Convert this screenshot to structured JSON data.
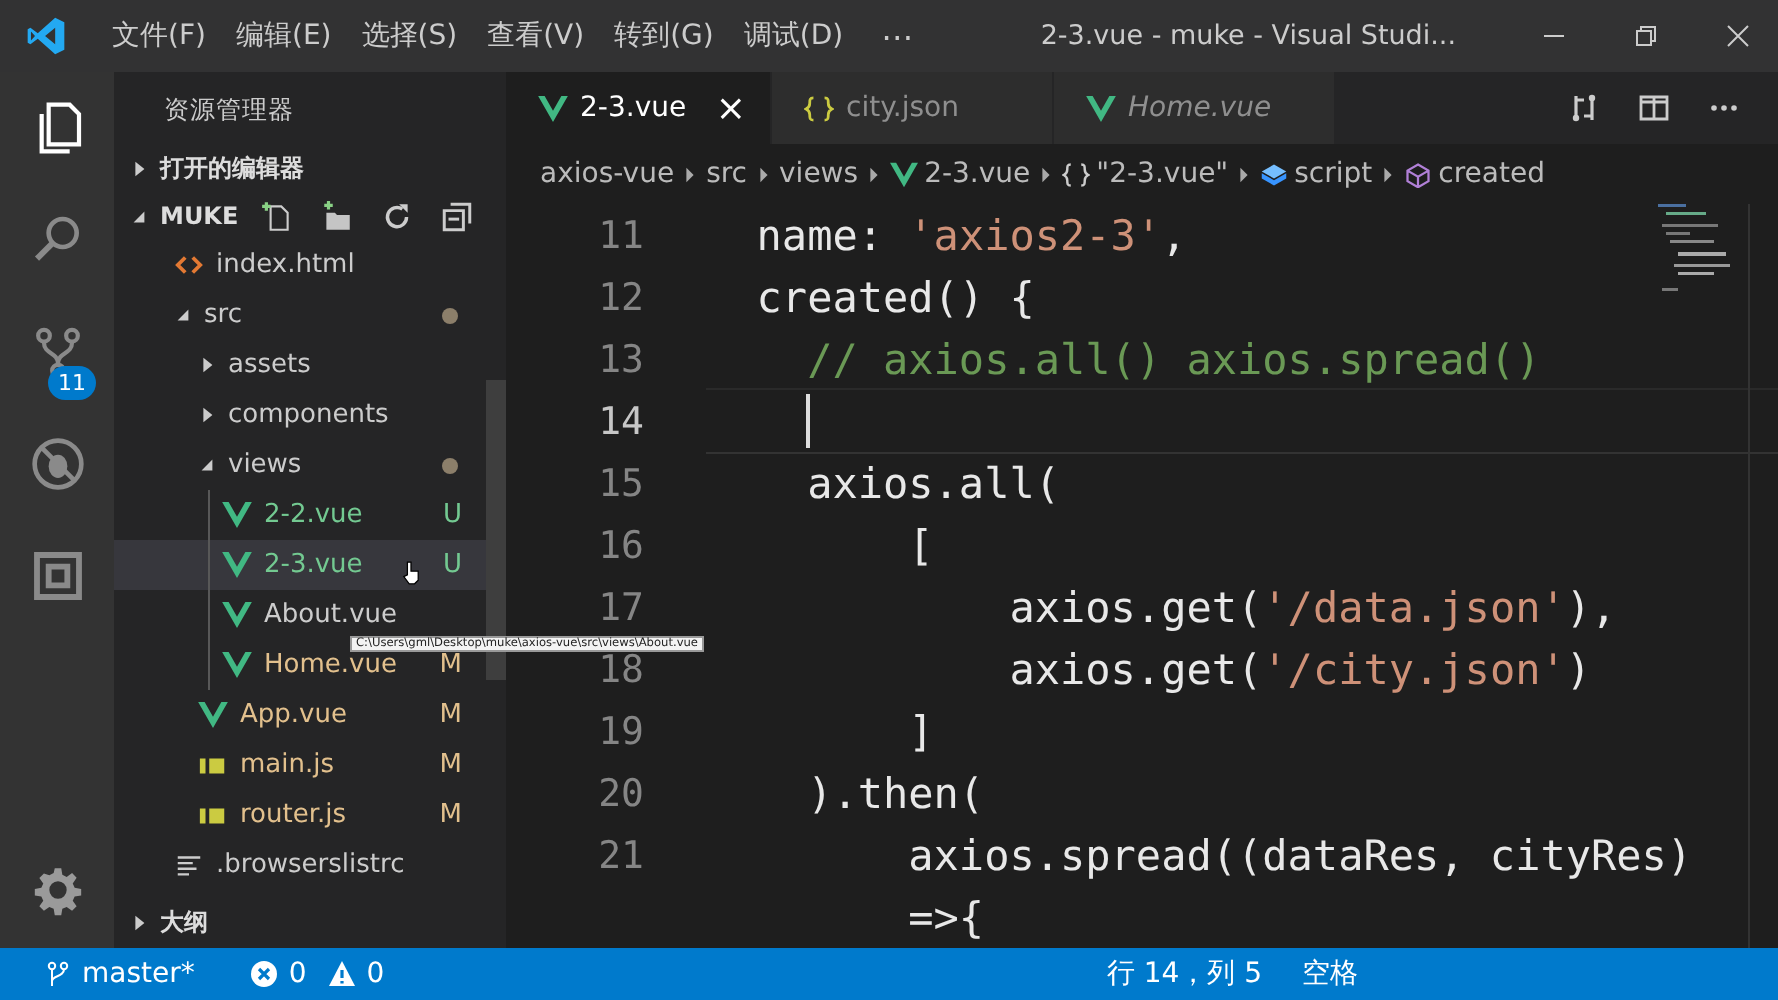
{
  "title_bar": {
    "menus": [
      "文件(F)",
      "编辑(E)",
      "选择(S)",
      "查看(V)",
      "转到(G)",
      "调试(D)"
    ],
    "more": "⋯",
    "title": "2-3.vue - muke - Visual Studi..."
  },
  "activity_bar": {
    "items": [
      {
        "kind": "explorer",
        "selected": true
      },
      {
        "kind": "search",
        "selected": false
      },
      {
        "kind": "git",
        "selected": false,
        "badge": "11"
      },
      {
        "kind": "debug",
        "selected": false
      },
      {
        "kind": "extensions",
        "selected": false
      }
    ]
  },
  "sidebar": {
    "title": "资源管理器",
    "open_editors": {
      "label": "打开的编辑器",
      "expanded": false
    },
    "folder": {
      "label": "MUKE",
      "expanded": true
    },
    "items": [
      {
        "name": "index.html",
        "kind": "html"
      },
      {
        "name": "src",
        "kind": "folder",
        "expanded": true,
        "modified": true,
        "children": [
          {
            "name": "assets",
            "kind": "folder",
            "expanded": false
          },
          {
            "name": "components",
            "kind": "folder",
            "expanded": false
          },
          {
            "name": "views",
            "kind": "folder",
            "expanded": true,
            "modified": true,
            "children": [
              {
                "name": "2-2.vue",
                "kind": "vue",
                "color": "#73c991",
                "badge": "U",
                "selected": false
              },
              {
                "name": "2-3.vue",
                "kind": "vue",
                "color": "#73c991",
                "badge": "U",
                "selected": true
              },
              {
                "name": "About.vue",
                "kind": "vue",
                "selected": false
              },
              {
                "name": "Home.vue",
                "kind": "vue",
                "color": "#e2c08d",
                "badge": "M",
                "selected": false
              }
            ]
          },
          {
            "name": "App.vue",
            "kind": "vue",
            "color": "#e2c08d",
            "badge": "M"
          },
          {
            "name": "main.js",
            "kind": "js",
            "color": "#e2c08d",
            "badge": "M"
          },
          {
            "name": "router.js",
            "kind": "js",
            "color": "#e2c08d",
            "badge": "M"
          }
        ]
      },
      {
        "name": ".browserslistrc",
        "kind": "text"
      }
    ],
    "tooltip": "C:\\Users\\gml\\Desktop\\muke\\axios-vue\\src\\views\\About.vue",
    "outline": {
      "label": "大纲",
      "expanded": false
    }
  },
  "tabs": [
    {
      "label": "2-3.vue",
      "kind": "vue",
      "selected": true,
      "preview": false,
      "close": "×"
    },
    {
      "label": "city.json",
      "kind": "json",
      "selected": false,
      "preview": false
    },
    {
      "label": "Home.vue",
      "kind": "vue",
      "selected": false,
      "preview": true
    }
  ],
  "breadcrumbs": [
    {
      "label": "axios-vue",
      "kind": "plain"
    },
    {
      "label": "src",
      "kind": "plain"
    },
    {
      "label": "views",
      "kind": "plain"
    },
    {
      "label": "2-3.vue",
      "kind": "vue"
    },
    {
      "label": "\"2-3.vue\"",
      "kind": "braces"
    },
    {
      "label": "script",
      "kind": "script"
    },
    {
      "label": "created",
      "kind": "method"
    }
  ],
  "code": [
    {
      "num": "11",
      "tokens": [
        {
          "t": "  name: ",
          "kind": "plain"
        },
        {
          "t": "'axios2-3'",
          "kind": "string"
        },
        {
          "t": ",",
          "kind": "plain"
        }
      ]
    },
    {
      "num": "12",
      "tokens": [
        {
          "t": "  created() {",
          "kind": "plain"
        }
      ]
    },
    {
      "num": "13",
      "tokens": [
        {
          "t": "    // axios.all() axios.spread()",
          "kind": "comment"
        }
      ]
    },
    {
      "num": "14",
      "current": true
    },
    {
      "num": "15",
      "tokens": [
        {
          "t": "    axios.all(",
          "kind": "plain"
        }
      ]
    },
    {
      "num": "16",
      "tokens": [
        {
          "t": "        [",
          "kind": "plain"
        }
      ]
    },
    {
      "num": "17",
      "tokens": [
        {
          "t": "            axios.get(",
          "kind": "plain"
        },
        {
          "t": "'/data.json'",
          "kind": "string"
        },
        {
          "t": "),",
          "kind": "plain"
        }
      ]
    },
    {
      "num": "18",
      "tokens": [
        {
          "t": "            axios.get(",
          "kind": "plain"
        },
        {
          "t": "'/city.json'",
          "kind": "string"
        },
        {
          "t": ")",
          "kind": "plain"
        }
      ]
    },
    {
      "num": "19",
      "tokens": [
        {
          "t": "        ]",
          "kind": "plain"
        }
      ]
    },
    {
      "num": "20",
      "tokens": [
        {
          "t": "    ).then(",
          "kind": "plain"
        }
      ]
    },
    {
      "num": "21",
      "tokens": [
        {
          "t": "        axios.spread((dataRes, cityRes)",
          "kind": "plain"
        }
      ]
    },
    {
      "tokens": [
        {
          "t": "        =>{",
          "kind": "plain"
        }
      ]
    }
  ],
  "status_bar": {
    "branch": "master*",
    "errors": "0",
    "warnings": "0",
    "position": "行 14，列 5",
    "indent": "空格"
  }
}
